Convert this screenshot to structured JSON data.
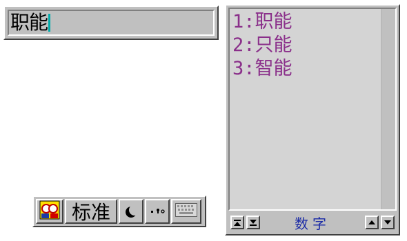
{
  "composition": {
    "text": "职能"
  },
  "status_bar": {
    "mode_label": "标准",
    "buttons": [
      {
        "name": "ime-logo",
        "icon": "ime-logo-icon"
      },
      {
        "name": "mode-toggle"
      },
      {
        "name": "width-toggle",
        "icon": "half-moon-icon"
      },
      {
        "name": "punctuation-toggle",
        "icon": "punctuation-icon",
        "glyph": "·,。"
      },
      {
        "name": "soft-keyboard",
        "icon": "keyboard-icon"
      }
    ]
  },
  "candidates": {
    "items": [
      "1:职能",
      "2:只能",
      "3:智能"
    ],
    "mode_label": "数字",
    "text_color": "#8a2f8a",
    "mode_color": "#1a2aa6"
  }
}
